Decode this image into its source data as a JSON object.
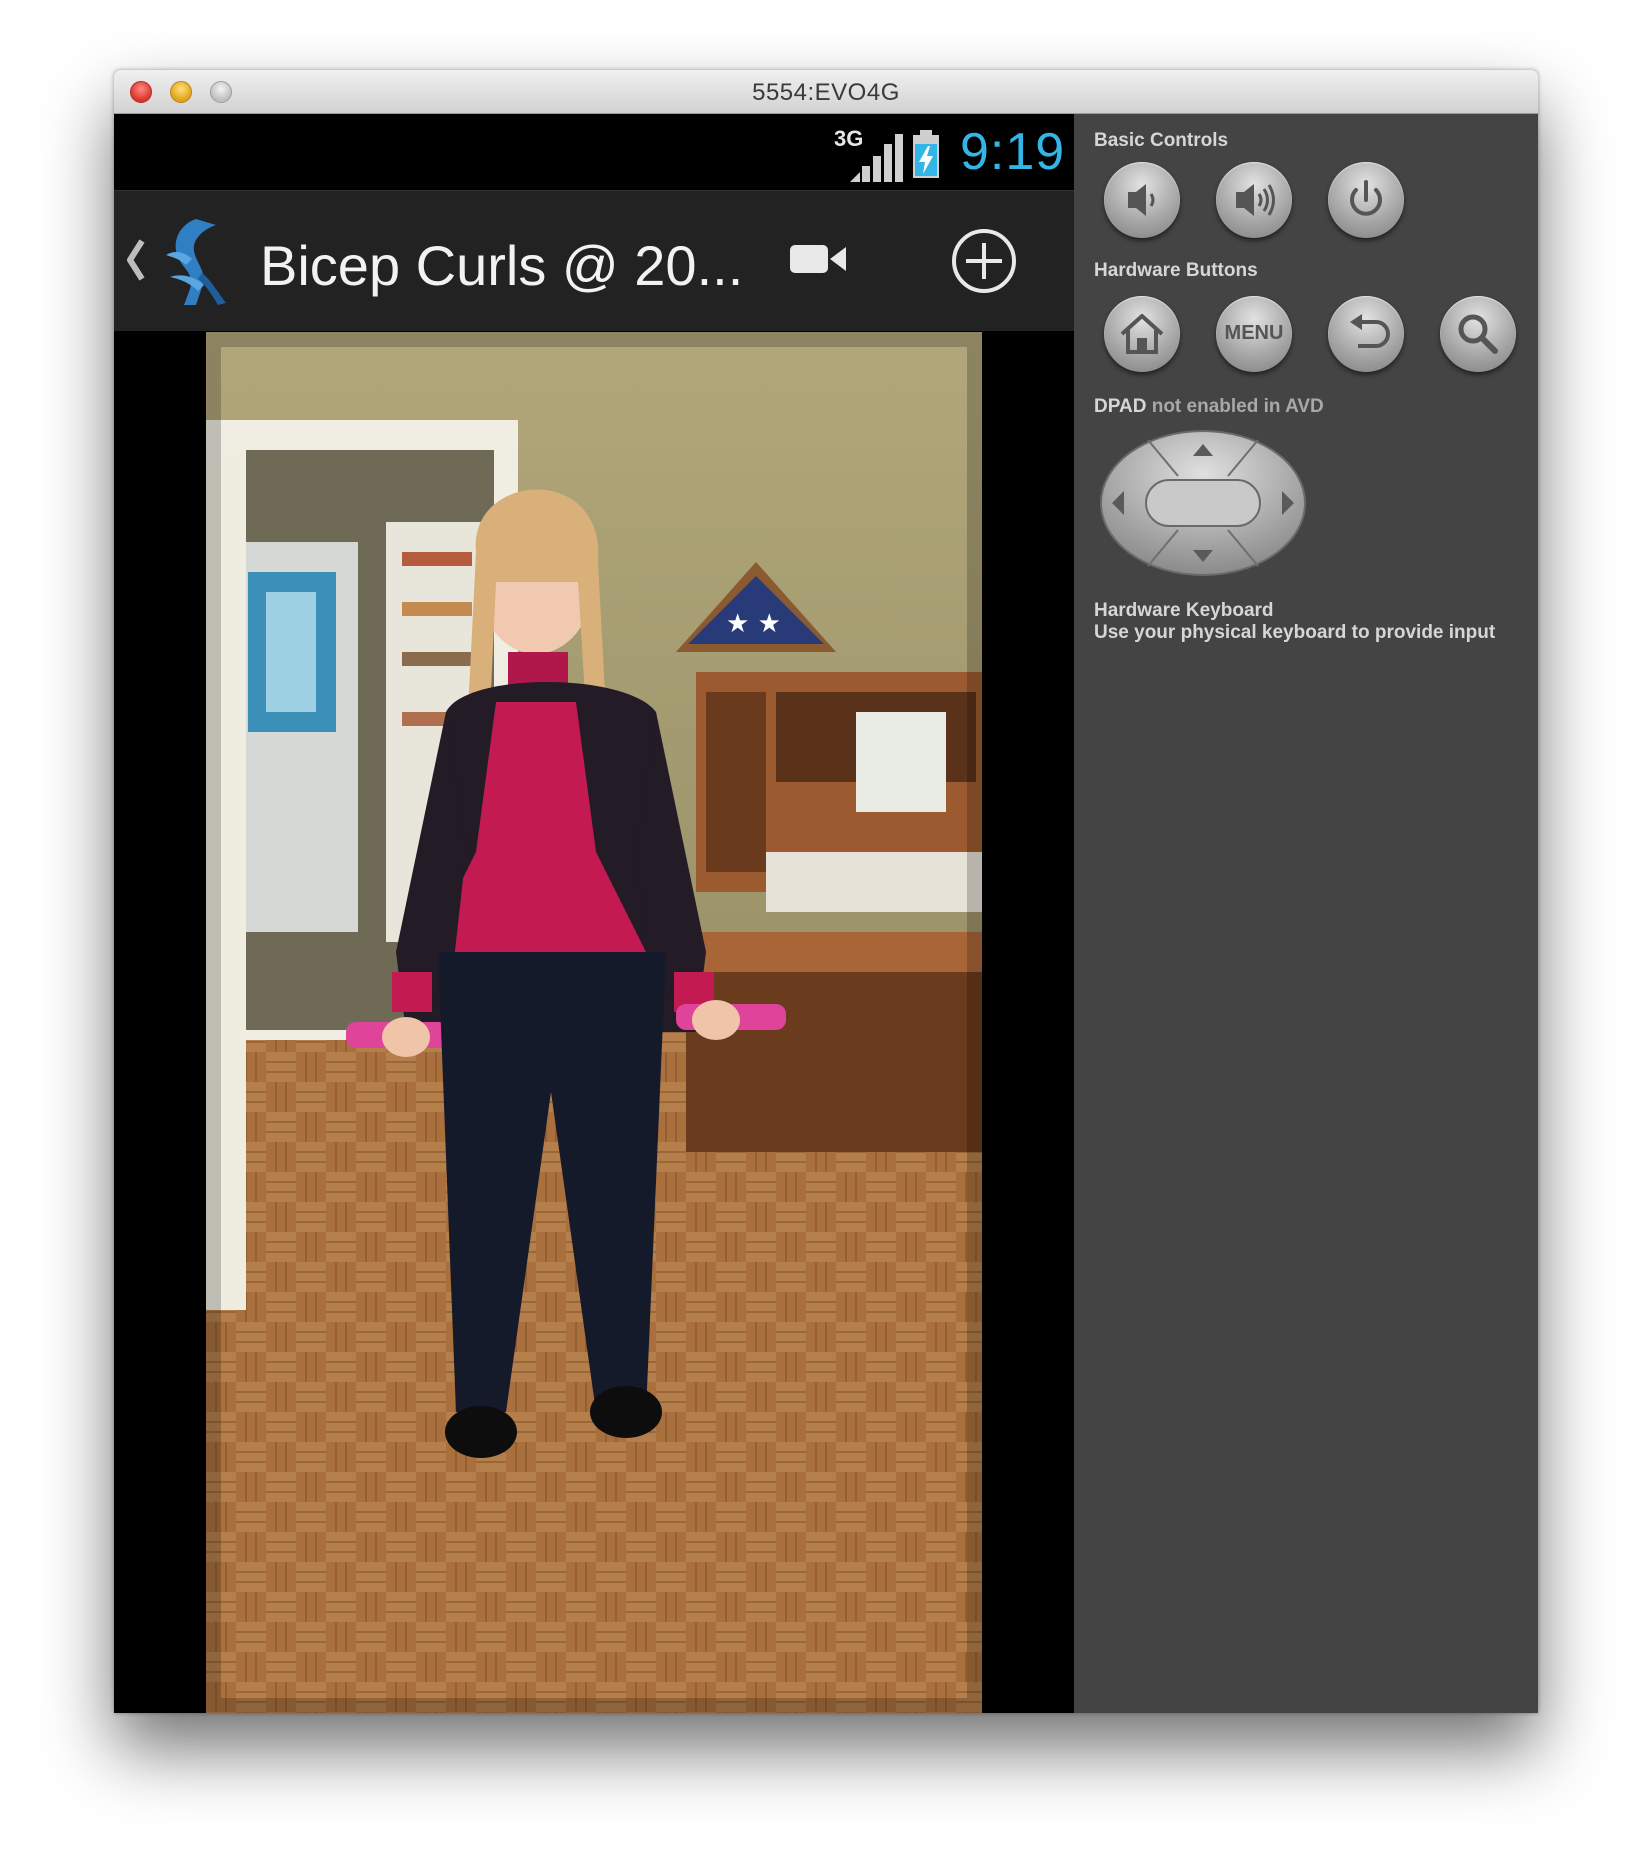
{
  "window": {
    "title": "5554:EVO4G"
  },
  "status_bar": {
    "network": "3G",
    "time": "9:19",
    "accent_color": "#33b5e5"
  },
  "action_bar": {
    "title": "Bicep Curls @ 20...",
    "icons": [
      "back-caret-icon",
      "app-logo",
      "video-camera-icon",
      "add-circle-icon"
    ]
  },
  "content": {
    "image": "photo of a woman holding pink dumbbells standing on a parquet floor"
  },
  "controls": {
    "basic_controls_label": "Basic Controls",
    "basic_controls": [
      "volume-down-icon",
      "volume-up-icon",
      "power-icon"
    ],
    "hardware_buttons_label": "Hardware Buttons",
    "hardware_buttons": [
      "home-icon",
      "menu",
      "back-icon",
      "search-icon"
    ],
    "menu_label": "MENU",
    "dpad_label_strong": "DPAD",
    "dpad_label_rest": "not enabled in AVD",
    "keyboard_title": "Hardware Keyboard",
    "keyboard_desc": "Use your physical keyboard to provide input"
  }
}
